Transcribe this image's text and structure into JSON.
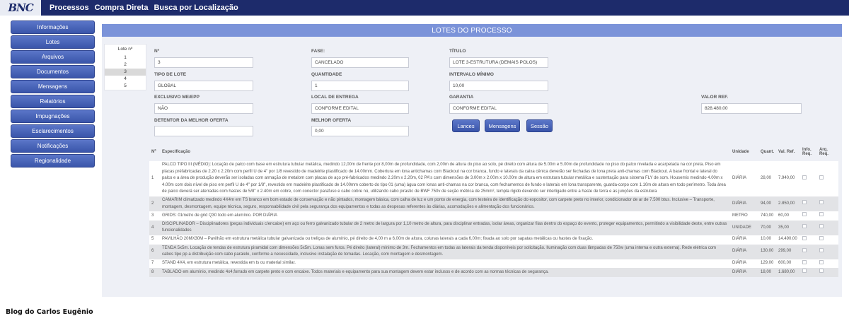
{
  "logo": "BNC",
  "topnav": [
    "Processos",
    "Compra Direta",
    "Busca por Localização"
  ],
  "sidebar": [
    "Informações",
    "Lotes",
    "Arquivos",
    "Documentos",
    "Mensagens",
    "Relatórios",
    "Impugnações",
    "Esclarecimentos",
    "Notificações",
    "Regionalidade"
  ],
  "blog": "Blog do Carlos Eugênio",
  "header_title": "LOTES DO PROCESSO",
  "lots": {
    "head": "Lote nº",
    "items": [
      "1",
      "2",
      "3",
      "4",
      "5"
    ],
    "selected": "3"
  },
  "fields": {
    "n_label": "Nº",
    "n_value": "3",
    "fase_label": "FASE:",
    "fase_value": "CANCELADO",
    "titulo_label": "TÍTULO",
    "titulo_value": "LOTE 3-ESTRUTURA (DEMAIS POLOS)",
    "tipo_label": "TIPO DE LOTE",
    "tipo_value": "GLOBAL",
    "qtd_label": "QUANTIDADE",
    "qtd_value": "1",
    "intervalo_label": "INTERVALO MÍNIMO",
    "intervalo_value": "10,00",
    "exclusivo_label": "EXCLUSIVO ME/EPP",
    "exclusivo_value": "NÃO",
    "local_label": "LOCAL DE ENTREGA",
    "local_value": "CONFORME EDITAL",
    "garantia_label": "GARANTIA",
    "garantia_value": "CONFORME EDITAL",
    "valor_label": "VALOR REF.",
    "valor_value": "828.480,00",
    "detentor_label": "DETENTOR DA MELHOR OFERTA",
    "detentor_value": "",
    "melhor_label": "MELHOR OFERTA",
    "melhor_value": "0,00"
  },
  "buttons": {
    "lances": "Lances",
    "mensagens": "Mensagens",
    "sessao": "Sessão"
  },
  "table": {
    "headers": [
      "Nº",
      "Especificação",
      "Unidade",
      "Quant.",
      "Val. Ref.",
      "Info. Req.",
      "Arq. Req."
    ],
    "rows": [
      {
        "n": "1",
        "spec": "PALCO TIPO III (MÉDIO): Locação de palco com base em estrutura tubular metálica, medindo 12,00m de frente por 8,00m de profundidade, com 2,00m de altura do piso ao solo, pé direito com altura de 5.00m e 5.00m de profundidade no piso do palco nivelada e acarpetada na cor preta. Piso em placas préfabricadas de 2.20 x 2.20m com perfil U de 4\" por 1/8 revestido de madeirite plastificado de 14.00mm. Cobertura em lona antichamas com Blackout na cor branca, fundo e laterais da caixa cênica deverão ser fechadas de lona preta anti-chamas com Blackout. A base frontal e lateral do palco e a área de produção deverão ser isoladas com armação de metalom com placas de aço pré-fabricados medindo 2.20m x 2.20m, 02 PA's com dimensões de 3.00m x 2.00m x 10.00m de altura em estrutura tubular metálica e sustentação para sistema FLY de som. Housemix medindo 4.00m x 4.00m com dois nível de piso em perfil U de 4\" por 1/8\", revestido em madeirite plastificado de 14.00mm coberto do tipo 01 (uma) água com lonas anti-chamas na cor branca, com fechamentos de fundo e laterais em lona transparente, guarda-corpo com 1.10m de altura em todo perímetro. Toda área de palco deverá ser aterradas com hastes de 5/8\" x 2.40m em cobre, com conector parafuso e cabo cobre nú, utilizando cabo pirastic de BWF 750v de seção métrica de 25mm², templa rígido devendo ser interligado entre a haste de terra e as junções da estrutura",
        "unidade": "DIÁRIA",
        "quant": "28,00",
        "valref": "7.940,00"
      },
      {
        "n": "2",
        "spec": "CAMARIM climatizado medindo 4X4m em TS branco em bom estado de conservação e não pintados, montagem básica, com calha de luz e um ponto de energia, com testeira de identificação do expositor, com carpete preto no interior, condicionador de ar de 7.500 btus. Inclusive – Transporte, montagem, desmontagem, equipe técnica, seguro, responsabilidade civil pela segurança dos equipamentos e todas as despesas referentes às diárias, acomodações e alimentação dos funcionários.",
        "unidade": "DIÁRIA",
        "quant": "94,00",
        "valref": "2.850,00"
      },
      {
        "n": "3",
        "spec": "GRIDS: 01metro de grid Q30 todo em alumínio. POR DIÁRIA",
        "unidade": "METRO",
        "quant": "740,00",
        "valref": "60,00"
      },
      {
        "n": "4",
        "spec": "DISCIPLINADOR – Disciplinadores (peças individuais c/encaixe) em aço ou ferro galvanizado tubular de 2 metro de largura por 1,10 metro de altura, para disciplinar entradas, isolar áreas, organizar filas dentro do espaço do evento, proteger equipamentos, permitindo a visibilidade deste, entre outras funcionalidades",
        "unidade": "UNIDADE",
        "quant": "70,00",
        "valref": "35,00"
      },
      {
        "n": "5",
        "spec": "PAVILHÃO 20MX30M – Pavilhão em estrutura metálica tubular galvanizada ou treliças de alumínio, pé direito de 4,00 m a 6,00m de altura, colunas laterais a cada 6,00m; fixada ao solo por sapatas metálicas ou hastes de fixação.",
        "unidade": "DIÁRIA",
        "quant": "10,00",
        "valref": "14.490,00"
      },
      {
        "n": "6",
        "spec": "TENDA 5x5m. Locação de tendas de estrutura piramidal com dimensões 5x5m. Lonas sem furos. Pé direito (lateral) mínimo de 3m. Fechamentos em todas as laterais da tenda disponíveis por solicitação. Iluminação com duas lâmpadas de 750w (uma interna e outra externa). Rede elétrica com cabos tipo pp a distribuição com cabo paralelo, conforme a necessidade, inclusive instalação de tomadas. Locação, com montagem e desmontagem.",
        "unidade": "DIÁRIA",
        "quant": "130,00",
        "valref": "299,00"
      },
      {
        "n": "7",
        "spec": "STAND 4X4, em estrutura metálica, revestida em ts ou material similar.",
        "unidade": "DIÁRIA",
        "quant": "129,00",
        "valref": "600,00"
      },
      {
        "n": "8",
        "spec": "TABLADO em alumínio, medindo 4x4,forrado em carpete preto e com encaixe. Todos materiais e equipamento para sua montagem devem estar inclusos e de acordo com as normas técnicas de segurança.",
        "unidade": "DIÁRIA",
        "quant": "18,00",
        "valref": "1.680,00"
      }
    ]
  }
}
